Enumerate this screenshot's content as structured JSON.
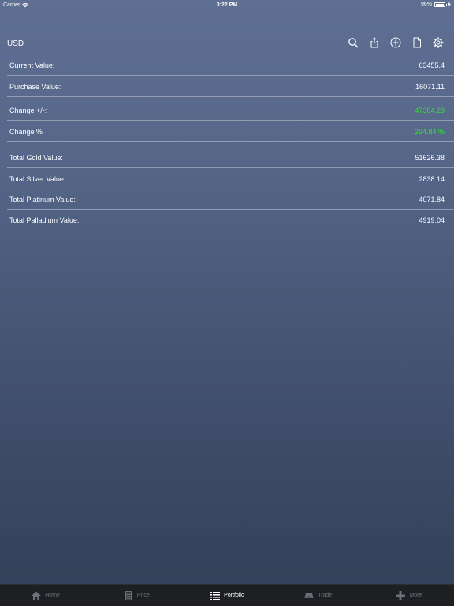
{
  "status_bar": {
    "carrier": "Carrier",
    "time": "3:22 PM",
    "battery": "96%",
    "battery_level": 0.96
  },
  "nav": {
    "title": "USD",
    "icons": [
      "search-icon",
      "share-icon",
      "add-icon",
      "document-icon",
      "gear-icon"
    ]
  },
  "rows": [
    {
      "label": "Current Value:",
      "value": "63455.4"
    },
    {
      "label": "Purchase Value:",
      "value": "16071.11"
    },
    {
      "label": "Change +/-:",
      "value": "47384.29",
      "color": "#2ee52e"
    },
    {
      "label": "Change %",
      "value": "294.84 %",
      "color": "#2ee52e"
    },
    {
      "label": "Total Gold Value:",
      "value": "51626.38"
    },
    {
      "label": "Total Silver Value:",
      "value": "2838.14"
    },
    {
      "label": "Total Platinum Value:",
      "value": "4071.84"
    },
    {
      "label": "Total Palladium Value:",
      "value": "4919.04"
    }
  ],
  "tabs": [
    {
      "label": "Home",
      "icon": "home-icon",
      "active": false
    },
    {
      "label": "Price",
      "icon": "calculator-icon",
      "active": false
    },
    {
      "label": "Portfolio",
      "icon": "list-icon",
      "active": true
    },
    {
      "label": "Trade",
      "icon": "gold-bars-icon",
      "active": false
    },
    {
      "label": "More",
      "icon": "plus-icon",
      "active": false
    }
  ]
}
